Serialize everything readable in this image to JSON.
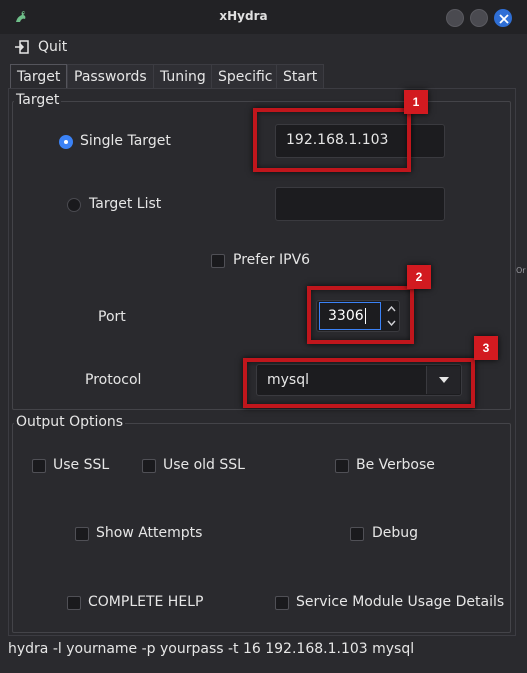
{
  "window": {
    "title": "xHydra"
  },
  "menu": {
    "quit_label": "Quit"
  },
  "tabs": [
    {
      "label": "Target",
      "active": true
    },
    {
      "label": "Passwords",
      "active": false
    },
    {
      "label": "Tuning",
      "active": false
    },
    {
      "label": "Specific",
      "active": false
    },
    {
      "label": "Start",
      "active": false
    }
  ],
  "target_group": {
    "title": "Target",
    "single_target_label": "Single Target",
    "single_target_selected": true,
    "single_target_value": "192.168.1.103",
    "target_list_label": "Target List",
    "target_list_selected": false,
    "target_list_value": "",
    "prefer_ipv6_label": "Prefer IPV6",
    "prefer_ipv6_checked": false,
    "port_label": "Port",
    "port_value": "3306",
    "protocol_label": "Protocol",
    "protocol_value": "mysql"
  },
  "output_group": {
    "title": "Output Options",
    "use_ssl_label": "Use SSL",
    "use_old_ssl_label": "Use old SSL",
    "be_verbose_label": "Be Verbose",
    "show_attempts_label": "Show Attempts",
    "debug_label": "Debug",
    "complete_help_label": "COMPLETE HELP",
    "service_module_label": "Service Module Usage Details"
  },
  "annotations": [
    "1",
    "2",
    "3"
  ],
  "status": {
    "command": "hydra -l yourname -p yourpass -t 16 192.168.1.103 mysql"
  },
  "edge_fragment": "Or",
  "colors": {
    "highlight": "#c0161c",
    "accent": "#3b82f6",
    "background": "#2a2a2e"
  },
  "icons": {
    "app": "hydra-logo-icon",
    "quit": "exit-icon",
    "close": "close-icon",
    "dropdown": "chevron-down-icon"
  }
}
